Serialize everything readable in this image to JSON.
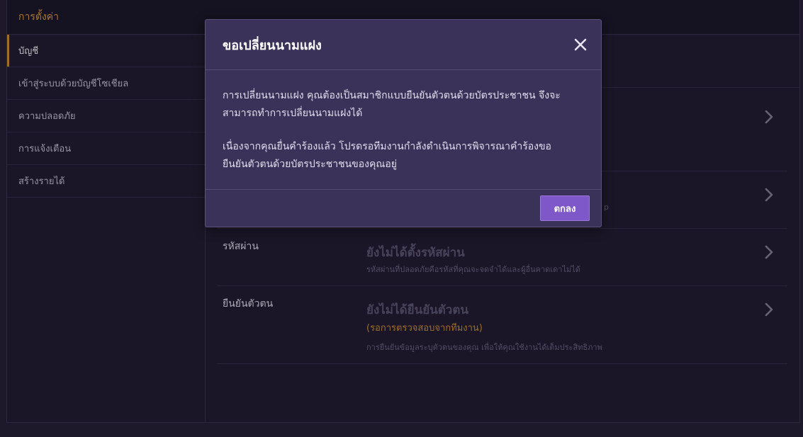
{
  "app": {
    "title": "การตั้งค่า"
  },
  "sidebar": {
    "items": [
      {
        "label": "บัญชี"
      },
      {
        "label": "เข้าสู่ระบบด้วยบัญชีโซเชียล"
      },
      {
        "label": "ความปลอดภัย"
      },
      {
        "label": "การแจ้งเตือน"
      },
      {
        "label": "สร้างรายได้"
      }
    ]
  },
  "settings": {
    "row2": {
      "note_tail": "p"
    },
    "password": {
      "label": "รหัสผ่าน",
      "value": "ยังไม่ได้ตั้งรหัสผ่าน",
      "note": "รหัสผ่านที่ปลอดภัยคือรหัสที่คุณจะจดจำได้และผู้อื่นคาดเดาไม่ได้"
    },
    "verify": {
      "label": "ยืนยันตัวตน",
      "value": "ยังไม่ได้ยืนยันตัวตน",
      "status": "(รอการตรวจสอบจากทีมงาน)",
      "note": "การยืนยันข้อมูลระบุตัวตนของคุณ เพื่อให้คุณใช้งานได้เต็มประสิทธิภาพ"
    }
  },
  "modal": {
    "title": "ขอเปลี่ยนนามแฝง",
    "paragraph1_line1": "การเปลี่ยนนามแฝง คุณต้องเป็นสมาชิกแบบยืนยันตัวตนด้วยบัตรประชาชน จึงจะ",
    "paragraph1_line2": "สามารถทำการเปลี่ยนนามแฝงได้",
    "paragraph2_line1": "เนื่องจากคุณยื่นคำร้องแล้ว โปรดรอทีมงานกำลังดำเนินการพิจารณาคำร้องขอ",
    "paragraph2_line2": "ยืนยันตัวตนด้วยบัตรประชาชนของคุณอยู่",
    "ok_label": "ตกลง"
  },
  "colors": {
    "accent": "#d9952e",
    "primary_button": "#7e57c8",
    "modal_bg": "#3a3258",
    "page_bg": "#201c30"
  }
}
